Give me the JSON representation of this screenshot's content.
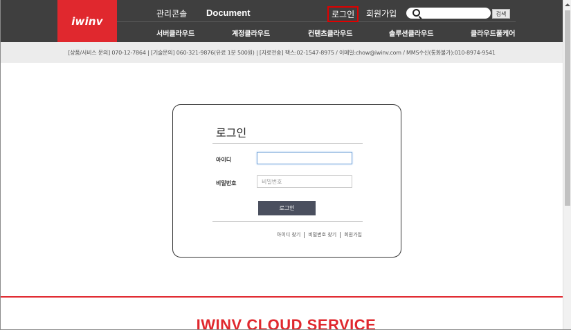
{
  "header": {
    "logo": "iwinv",
    "top_links": {
      "admin_console": "관리콘솔",
      "document": "Document",
      "login": "로그인",
      "signup": "회원가입"
    },
    "search": {
      "value": "",
      "button_label": "검색"
    },
    "sub_nav": [
      "서버클라우드",
      "계정클라우드",
      "컨텐츠클라우드",
      "솔루션클라우드",
      "클라우드풀케어"
    ]
  },
  "contact_bar": {
    "text": "[상품/서비스 문의] 070-12-7864 | [기술문의] 060-321-9876(유료 1분 500원) | [자료전송] 팩스:02-1547-8975 / 이메일:chow@iwinv.com / MMS수신(통화불가):010-8974-9541"
  },
  "login": {
    "title": "로그인",
    "id_label": "아이디",
    "id_value": "",
    "pw_label": "비밀번호",
    "pw_placeholder": "비밀번호",
    "button_label": "로그인",
    "links": [
      "아이디 찾기",
      "비밀번호 찾기",
      "회원가입"
    ]
  },
  "footer": {
    "title": "IWINV CLOUD SERVICE"
  },
  "colors": {
    "brand_red": "#e0282e",
    "header_bg": "#3f3f3f",
    "button_bg": "#4a4f5e"
  }
}
